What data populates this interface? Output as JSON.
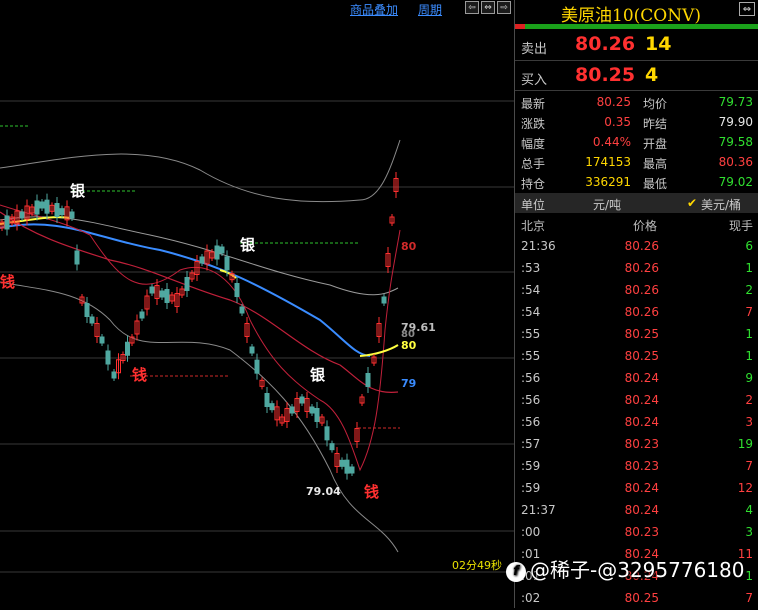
{
  "toolbar": {
    "overlay_label": "商品叠加",
    "period_label": "周期",
    "nav_left": "⇦",
    "nav_both": "⇔",
    "nav_right": "⇨"
  },
  "chart": {
    "timer": "02分49秒",
    "annotations": {
      "silver_1": "银",
      "silver_2": "银",
      "silver_3": "银",
      "money_1": "钱",
      "money_2": "钱",
      "money_3": "钱",
      "low_value": "79.04",
      "price_79_61": "79.61",
      "price_80_grey": "80",
      "price_80_yellow": "80",
      "price_80_red": "80",
      "price_79_blue": "79"
    },
    "colors": {
      "up": "#ff3030",
      "down": "#4fa8a0",
      "ma_blue": "#3a8cff",
      "ma_yellow": "#ffff40",
      "grid": "#707070"
    }
  },
  "panel": {
    "title": "美原油10(CONV)",
    "title_icon": "⇔",
    "sell": {
      "label": "卖出",
      "price": "80.26",
      "volume": "14"
    },
    "buy": {
      "label": "买入",
      "price": "80.25",
      "volume": "4"
    },
    "stats": [
      {
        "l1": "最新",
        "v1": "80.25",
        "c1": "#ff4040",
        "l2": "均价",
        "v2": "79.73",
        "c2": "#30e030"
      },
      {
        "l1": "涨跌",
        "v1": "0.35",
        "c1": "#ff4040",
        "l2": "昨结",
        "v2": "79.90",
        "c2": "#e8e8e8"
      },
      {
        "l1": "幅度",
        "v1": "0.44%",
        "c1": "#ff4040",
        "l2": "开盘",
        "v2": "79.58",
        "c2": "#30e030"
      },
      {
        "l1": "总手",
        "v1": "174153",
        "c1": "#ffd700",
        "l2": "最高",
        "v2": "80.36",
        "c2": "#ff4040"
      },
      {
        "l1": "持仓",
        "v1": "336291",
        "c1": "#ffd700",
        "l2": "最低",
        "v2": "79.02",
        "c2": "#30e030"
      }
    ],
    "unit": {
      "label": "单位",
      "value": "元/吨",
      "check": "✔",
      "alt": "美元/桶"
    },
    "trade_header": {
      "time": "北京",
      "price": "价格",
      "volume": "现手"
    },
    "trades": [
      {
        "time": "21:36",
        "price": "80.26",
        "vol": "6",
        "color": "#30e030"
      },
      {
        "time": ":53",
        "price": "80.26",
        "vol": "1",
        "color": "#30e030"
      },
      {
        "time": ":54",
        "price": "80.26",
        "vol": "2",
        "color": "#30e030"
      },
      {
        "time": ":54",
        "price": "80.26",
        "vol": "7",
        "color": "#ff4040"
      },
      {
        "time": ":55",
        "price": "80.25",
        "vol": "1",
        "color": "#30e030"
      },
      {
        "time": ":55",
        "price": "80.25",
        "vol": "1",
        "color": "#30e030"
      },
      {
        "time": ":56",
        "price": "80.24",
        "vol": "9",
        "color": "#30e030"
      },
      {
        "time": ":56",
        "price": "80.24",
        "vol": "2",
        "color": "#ff4040"
      },
      {
        "time": ":56",
        "price": "80.24",
        "vol": "3",
        "color": "#ff4040"
      },
      {
        "time": ":57",
        "price": "80.23",
        "vol": "19",
        "color": "#30e030"
      },
      {
        "time": ":59",
        "price": "80.23",
        "vol": "7",
        "color": "#ff4040"
      },
      {
        "time": ":59",
        "price": "80.24",
        "vol": "12",
        "color": "#ff4040"
      },
      {
        "time": "21:37",
        "price": "80.24",
        "vol": "4",
        "color": "#30e030"
      },
      {
        "time": ":00",
        "price": "80.23",
        "vol": "3",
        "color": "#30e030"
      },
      {
        "time": ":01",
        "price": "80.24",
        "vol": "11",
        "color": "#ff4040"
      },
      {
        "time": ":01",
        "price": "80.24",
        "vol": "1",
        "color": "#30e030"
      },
      {
        "time": ":02",
        "price": "80.25",
        "vol": "7",
        "color": "#ff4040"
      }
    ],
    "watermark": "@稀子-@3295776180",
    "watermark_icon": "f"
  }
}
